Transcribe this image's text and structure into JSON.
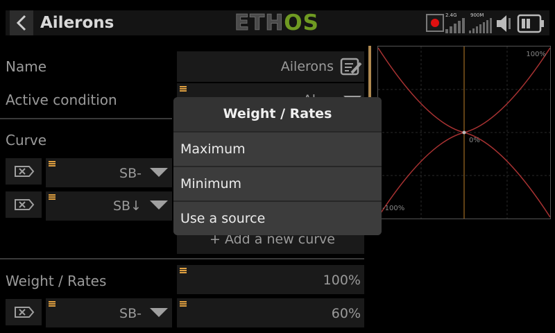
{
  "header": {
    "title": "Ailerons",
    "logo_left": "ETH",
    "logo_right": "OS",
    "status": {
      "rx_label": "2.4G",
      "ext_label": "900M"
    }
  },
  "form": {
    "name_label": "Name",
    "name_value": "Ailerons",
    "active_condition_label": "Active condition",
    "active_condition_value": "Al",
    "curve_label": "Curve",
    "curve_rows": [
      {
        "source": "SB-"
      },
      {
        "source": "SB↓"
      }
    ],
    "add_curve_label": "+ Add a new curve",
    "weight_label": "Weight / Rates",
    "weight_value": "100%",
    "rate_row": {
      "source": "SB-",
      "value": "60%"
    }
  },
  "modal": {
    "title": "Weight / Rates",
    "options": [
      "Maximum",
      "Minimum",
      "Use a source"
    ]
  },
  "graph": {
    "top_label": "100%",
    "center_label": "0%",
    "bottom_label": "-100%",
    "curve_color": "#a83232",
    "axis_color": "#c0822a"
  },
  "colors": {
    "accent": "#e0a040",
    "brand_green": "#6f9a22",
    "record": "#e01010"
  }
}
